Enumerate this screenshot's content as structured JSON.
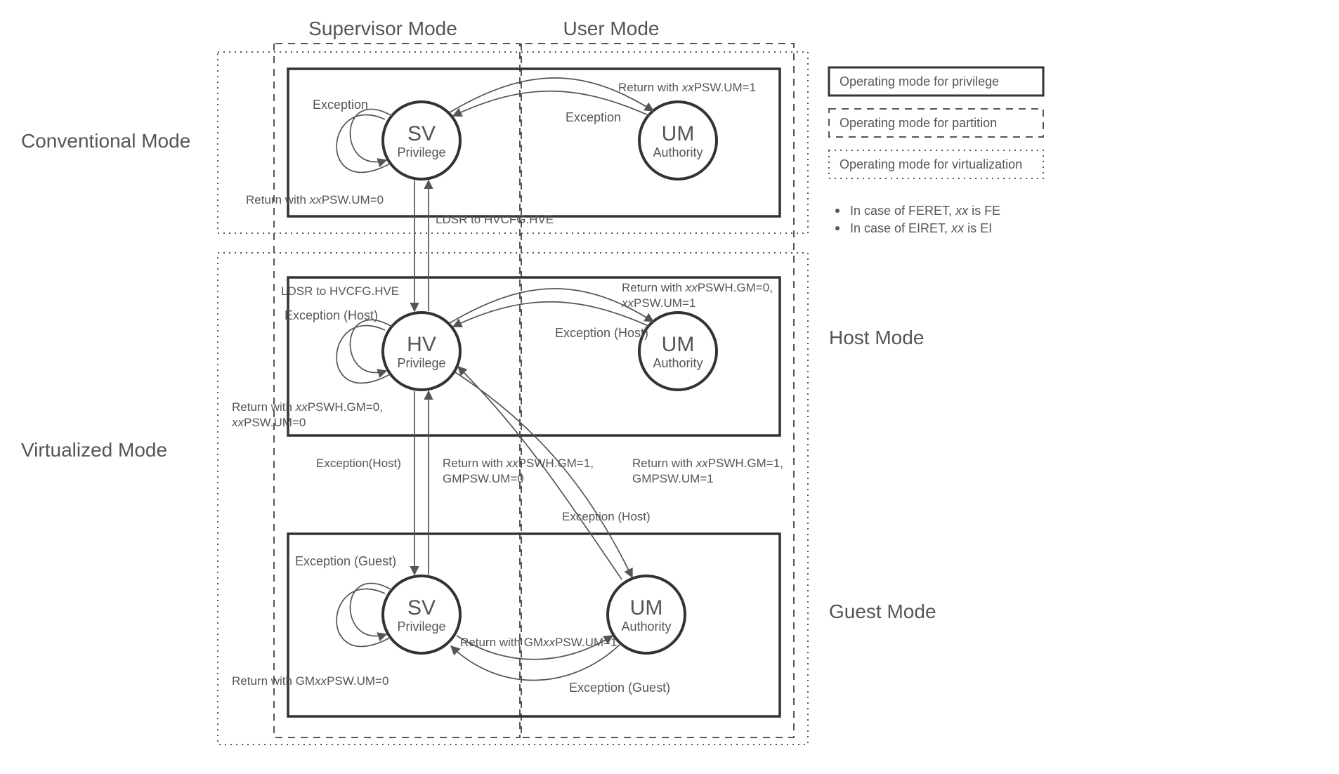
{
  "columns": {
    "supervisor": "Supervisor  Mode",
    "user": "User Mode"
  },
  "rows": {
    "conventional": "Conventional Mode",
    "virtualized": "Virtualized Mode",
    "host": "Host Mode",
    "guest": "Guest Mode"
  },
  "nodes": {
    "conv_sv": {
      "title": "SV",
      "sub": "Privilege"
    },
    "conv_um": {
      "title": "UM",
      "sub": "Authority"
    },
    "host_hv": {
      "title": "HV",
      "sub": "Privilege"
    },
    "host_um": {
      "title": "UM",
      "sub": "Authority"
    },
    "guest_sv": {
      "title": "SV",
      "sub": "Privilege"
    },
    "guest_um": {
      "title": "UM",
      "sub": "Authority"
    }
  },
  "edges": {
    "conv_sv_self_exc": "Exception",
    "conv_sv_self_ret": "Return with xxPSW.UM=0",
    "conv_sv_to_um_ret": "Return with xxPSW.UM=1",
    "conv_um_to_sv_exc": "Exception",
    "conv_to_host_ldsr": "LDSR to HVCFG.HVE",
    "host_to_conv_ldsr": "LDSR to HVCFG.HVE",
    "host_hv_self_exc": "Exception (Host)",
    "host_hv_self_ret_a": "Return with xxPSWH.GM=0,",
    "host_hv_self_ret_b": "xxPSW.UM=0",
    "host_hv_to_um_ret_a": "Return with xxPSWH.GM=0,",
    "host_hv_to_um_ret_b": "xxPSW.UM=1",
    "host_um_to_hv_exc": "Exception (Host)",
    "host_hv_to_gsv_ret_a": "Return with xxPSWH.GM=1,",
    "host_hv_to_gsv_ret_b": "GMPSW.UM=0",
    "gsv_to_hv_exc": "Exception(Host)",
    "host_hv_to_gum_ret_a": "Return with xxPSWH.GM=1,",
    "host_hv_to_gum_ret_b": "GMPSW.UM=1",
    "gum_to_hv_exc": "Exception (Host)",
    "guest_sv_self_exc": "Exception (Guest)",
    "guest_sv_self_ret": "Return with GMxxPSW.UM=0",
    "guest_sv_to_um_ret": "Return with GMxxPSW.UM=1",
    "guest_um_to_sv_exc": "Exception (Guest)"
  },
  "legend": {
    "privilege": "Operating mode for privilege",
    "partition": "Operating mode for partition",
    "virtualization": "Operating mode for virtualization"
  },
  "notes": {
    "feret": "In case of FERET, xx is FE",
    "eiret": "In case of EIRET, xx is EI"
  }
}
